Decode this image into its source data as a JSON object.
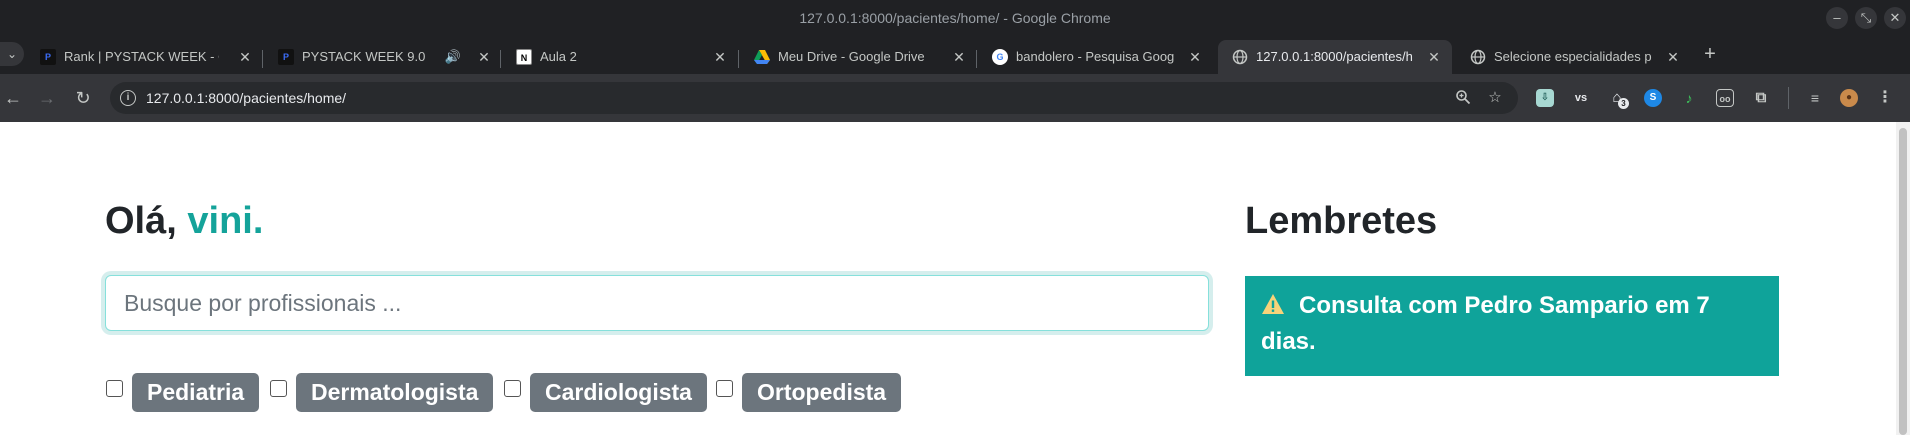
{
  "window": {
    "title": "127.0.0.1:8000/pacientes/home/ - Google Chrome"
  },
  "tabs": [
    {
      "label": "Rank | PYSTACK WEEK - O",
      "favicon": "pystack-icon",
      "active": false
    },
    {
      "label": "PYSTACK WEEK 9.0",
      "favicon": "pystack-icon",
      "active": false,
      "audio": true
    },
    {
      "label": "Aula 2",
      "favicon": "notion-icon",
      "active": false
    },
    {
      "label": "Meu Drive - Google Drive",
      "favicon": "google-drive-icon",
      "active": false
    },
    {
      "label": "bandolero - Pesquisa Goog",
      "favicon": "google-icon",
      "active": false
    },
    {
      "label": "127.0.0.1:8000/pacientes/h",
      "favicon": "globe-icon",
      "active": true
    },
    {
      "label": "Selecione especialidades p",
      "favicon": "globe-icon",
      "active": false
    }
  ],
  "toolbar": {
    "url": "127.0.0.1:8000/pacientes/home/",
    "extension_badge": "3"
  },
  "page": {
    "greeting_prefix": "Olá, ",
    "user_name": "vini.",
    "search_placeholder": "Busque por profissionais ...",
    "specialties": [
      "Pediatria",
      "Dermatologista",
      "Cardiologista",
      "Ortopedista"
    ],
    "reminders_title": "Lembretes",
    "reminder_text": "Consulta com Pedro Sampario em 7 dias."
  },
  "colors": {
    "accent": "#14a39a",
    "alert_bg": "#0fa39a",
    "badge_bg": "#6c757d",
    "chrome_dark": "#202124",
    "chrome_toolbar": "#35363a"
  }
}
